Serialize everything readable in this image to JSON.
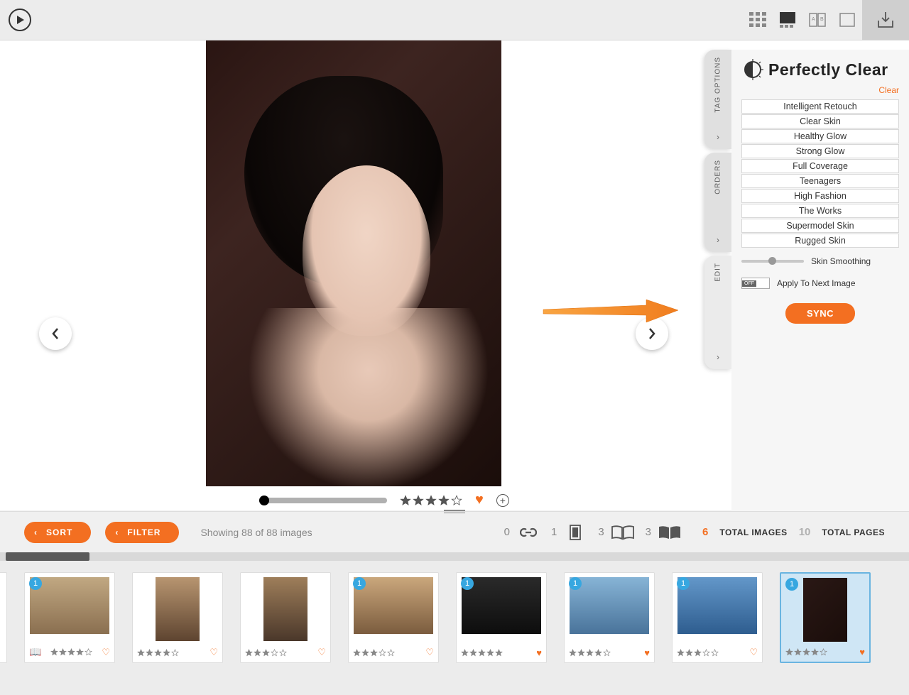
{
  "panel": {
    "brand": "Perfectly Clear",
    "clear_link": "Clear",
    "presets": [
      "Intelligent Retouch",
      "Clear Skin",
      "Healthy Glow",
      "Strong Glow",
      "Full Coverage",
      "Teenagers",
      "High Fashion",
      "The Works",
      "Supermodel Skin",
      "Rugged Skin"
    ],
    "slider_label": "Skin Smoothing",
    "apply_label": "Apply To Next Image",
    "toggle_state": "OFF",
    "sync_label": "SYNC"
  },
  "side_tabs": {
    "tag": "TAG OPTIONS",
    "orders": "ORDERS",
    "edit": "EDIT"
  },
  "controls": {
    "sort": "SORT",
    "filter": "FILTER",
    "status": "Showing 88 of 88 images",
    "counts": {
      "link": "0",
      "single": "1",
      "double": "3",
      "spread": "3"
    },
    "totals": {
      "images_n": "6",
      "images_l": "TOTAL IMAGES",
      "pages_n": "10",
      "pages_l": "TOTAL PAGES"
    }
  },
  "main_image": {
    "rating": 4,
    "favorite": true
  },
  "thumbs": [
    {
      "badge": "1",
      "rating": 4,
      "fav": false,
      "orient": "landscape",
      "book": true
    },
    {
      "badge": "",
      "rating": 4,
      "fav": false,
      "orient": "portrait",
      "book": false
    },
    {
      "badge": "",
      "rating": 3,
      "fav": false,
      "orient": "portrait",
      "book": false
    },
    {
      "badge": "1",
      "rating": 3,
      "fav": false,
      "orient": "landscape",
      "book": false
    },
    {
      "badge": "1",
      "rating": 5,
      "fav": true,
      "orient": "landscape",
      "book": false
    },
    {
      "badge": "1",
      "rating": 4,
      "fav": true,
      "orient": "landscape",
      "book": false
    },
    {
      "badge": "1",
      "rating": 3,
      "fav": false,
      "orient": "landscape",
      "book": false
    },
    {
      "badge": "1",
      "rating": 4,
      "fav": true,
      "orient": "portrait",
      "book": false,
      "selected": true
    }
  ],
  "colors": {
    "accent": "#f36f21"
  }
}
